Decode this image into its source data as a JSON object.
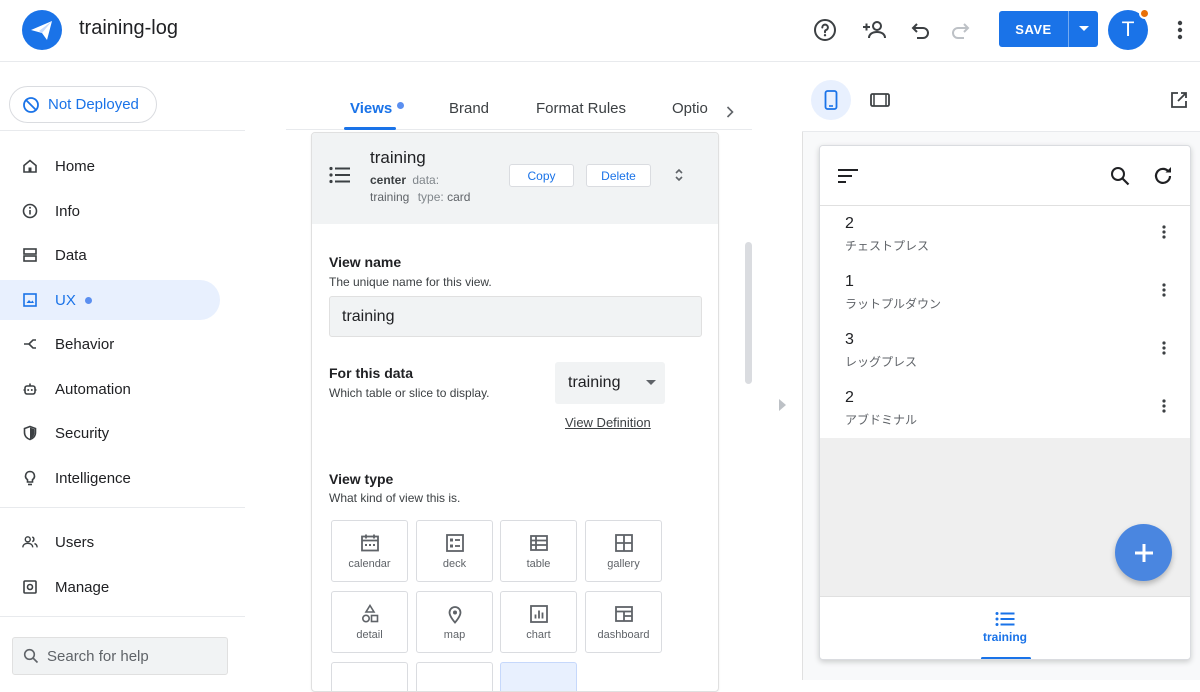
{
  "header": {
    "app_name": "training-log",
    "save_label": "SAVE",
    "avatar_initial": "T",
    "brand_color": "#1a73e8"
  },
  "sidebar": {
    "deploy_status": "Not Deployed",
    "items": [
      {
        "label": "Home",
        "icon": "home-icon"
      },
      {
        "label": "Info",
        "icon": "info-icon"
      },
      {
        "label": "Data",
        "icon": "data-icon"
      },
      {
        "label": "UX",
        "icon": "ux-icon",
        "active": true
      },
      {
        "label": "Behavior",
        "icon": "behavior-icon"
      },
      {
        "label": "Automation",
        "icon": "automation-icon"
      },
      {
        "label": "Security",
        "icon": "security-icon"
      },
      {
        "label": "Intelligence",
        "icon": "intelligence-icon"
      }
    ],
    "secondary_items": [
      {
        "label": "Users",
        "icon": "users-icon"
      },
      {
        "label": "Manage",
        "icon": "manage-icon"
      }
    ],
    "search_placeholder": "Search for help"
  },
  "editor": {
    "tabs": [
      "Views",
      "Brand",
      "Format Rules",
      "Optio"
    ],
    "view_card": {
      "name": "training",
      "position": "center",
      "data_label": "data:",
      "data_value": "training",
      "type_label": "type:",
      "type_value": "card",
      "copy_label": "Copy",
      "delete_label": "Delete"
    },
    "view_name": {
      "title": "View name",
      "desc": "The unique name for this view.",
      "value": "training"
    },
    "for_data": {
      "title": "For this data",
      "desc": "Which table or slice to display.",
      "value": "training",
      "link": "View Definition"
    },
    "view_type": {
      "title": "View type",
      "desc": "What kind of view this is.",
      "options": [
        "calendar",
        "deck",
        "table",
        "gallery",
        "detail",
        "map",
        "chart",
        "dashboard"
      ]
    }
  },
  "preview": {
    "rows": [
      {
        "num": "2",
        "name": "チェストプレス"
      },
      {
        "num": "1",
        "name": "ラットプルダウン"
      },
      {
        "num": "3",
        "name": "レッグプレス"
      },
      {
        "num": "2",
        "name": "アブドミナル"
      }
    ],
    "bottom_tab": "training"
  }
}
